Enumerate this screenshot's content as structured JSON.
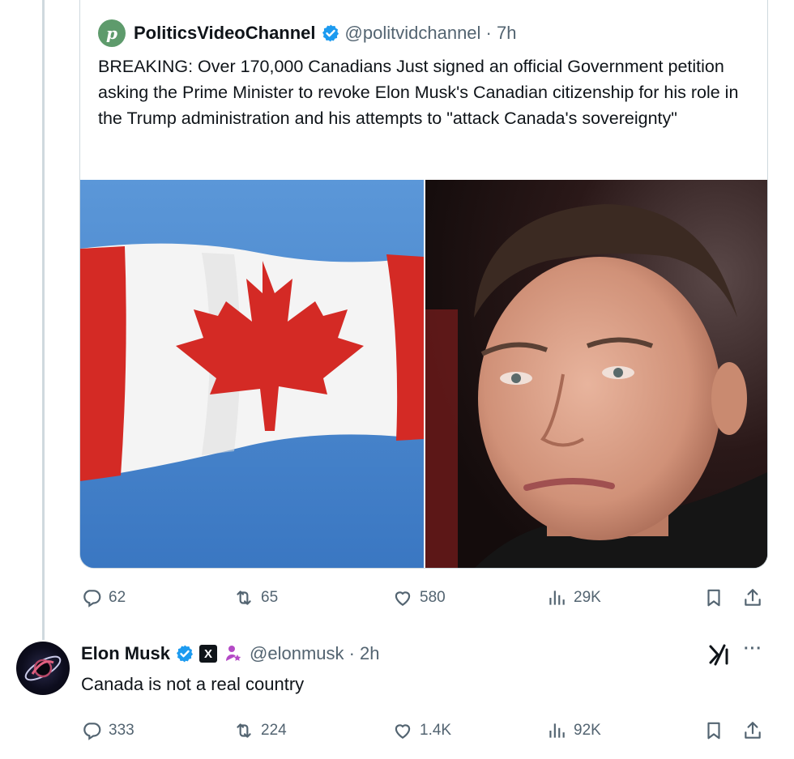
{
  "quoted_post": {
    "avatar_letter": "p",
    "author_name": "PoliticsVideoChannel",
    "handle_time": "@politvidchannel · 7h",
    "text": "BREAKING: Over 170,000 Canadians Just signed an official Government petition asking the Prime Minister to revoke Elon Musk's Canadian citizenship for his role in the Trump administration and his attempts to \"attack Canada's sovereignty\"",
    "media": [
      "canadian-flag-photo",
      "man-portrait-photo"
    ],
    "actions": {
      "replies": "62",
      "reposts": "65",
      "likes": "580",
      "views": "29K"
    }
  },
  "reply_post": {
    "author_name": "Elon Musk",
    "x_badge": "X",
    "handle_time": "@elonmusk · 2h",
    "text": "Canada is not a real country",
    "more": "···",
    "actions": {
      "replies": "333",
      "reposts": "224",
      "likes": "1.4K",
      "views": "92K"
    }
  },
  "colors": {
    "verified_blue": "#1d9bf0",
    "text_primary": "#0f1419",
    "text_secondary": "#536471",
    "border": "#cfd9de",
    "affiliation_purple": "#b44ac6"
  }
}
